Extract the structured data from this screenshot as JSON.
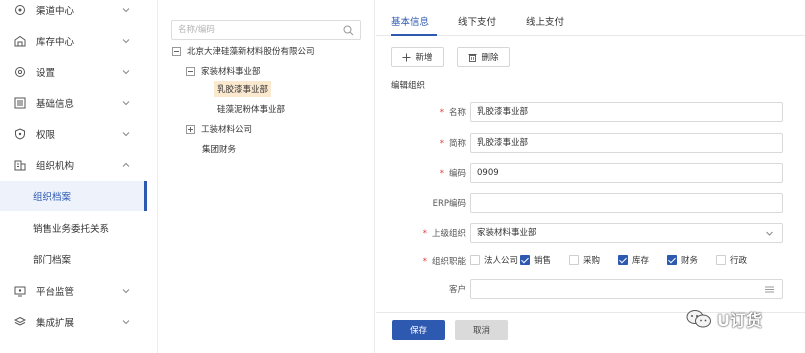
{
  "sidebar": {
    "items": [
      {
        "label": "渠道中心",
        "icon": "channel-icon"
      },
      {
        "label": "库存中心",
        "icon": "warehouse-icon"
      },
      {
        "label": "设置",
        "icon": "settings-icon"
      },
      {
        "label": "基础信息",
        "icon": "info-list-icon"
      },
      {
        "label": "权限",
        "icon": "shield-icon"
      },
      {
        "label": "组织机构",
        "icon": "org-icon"
      }
    ],
    "sub_items": [
      {
        "label": "组织档案",
        "active": true
      },
      {
        "label": "销售业务委托关系",
        "active": false
      },
      {
        "label": "部门档案",
        "active": false
      }
    ],
    "items_after": [
      {
        "label": "平台监管",
        "icon": "monitor-icon"
      },
      {
        "label": "集成扩展",
        "icon": "layers-icon"
      }
    ]
  },
  "tree": {
    "search_placeholder": "名称/编码",
    "nodes": [
      {
        "label": "北京大津硅藻新材料股份有限公司",
        "toggle": "minus"
      },
      {
        "label": "家装材料事业部",
        "toggle": "minus"
      },
      {
        "label": "乳胶漆事业部",
        "selected": true
      },
      {
        "label": "硅藻泥粉体事业部"
      },
      {
        "label": "工装材料公司",
        "toggle": "plus"
      },
      {
        "label": "集团财务"
      }
    ]
  },
  "tabs": [
    {
      "label": "基本信息",
      "active": true
    },
    {
      "label": "线下支付",
      "active": false
    },
    {
      "label": "线上支付",
      "active": false
    }
  ],
  "toolbar": {
    "add_label": "新增",
    "delete_label": "删除"
  },
  "section_title": "编辑组织",
  "form": {
    "name": {
      "label": "名称",
      "required": true,
      "value": "乳胶漆事业部"
    },
    "short_name": {
      "label": "简称",
      "required": true,
      "value": "乳胶漆事业部"
    },
    "code": {
      "label": "编码",
      "required": true,
      "value": "0909"
    },
    "erp_code": {
      "label": "ERP编码",
      "required": false,
      "value": ""
    },
    "parent_org": {
      "label": "上级组织",
      "required": true,
      "value": "家装材料事业部"
    },
    "org_functions": {
      "label": "组织职能",
      "required": true,
      "options": [
        {
          "label": "法人公司",
          "checked": false
        },
        {
          "label": "销售",
          "checked": true
        },
        {
          "label": "采购",
          "checked": false
        },
        {
          "label": "库存",
          "checked": true
        },
        {
          "label": "财务",
          "checked": true
        },
        {
          "label": "行政",
          "checked": false
        }
      ]
    },
    "customer": {
      "label": "客户",
      "required": false,
      "value": ""
    }
  },
  "footer": {
    "save_label": "保存",
    "cancel_label": "取消"
  },
  "watermark": {
    "text": "U订货"
  },
  "colors": {
    "accent": "#2d59b0",
    "required": "#e03a3a",
    "selected_bg": "#fbe9cf",
    "active_row_bg": "#eef3fb"
  }
}
